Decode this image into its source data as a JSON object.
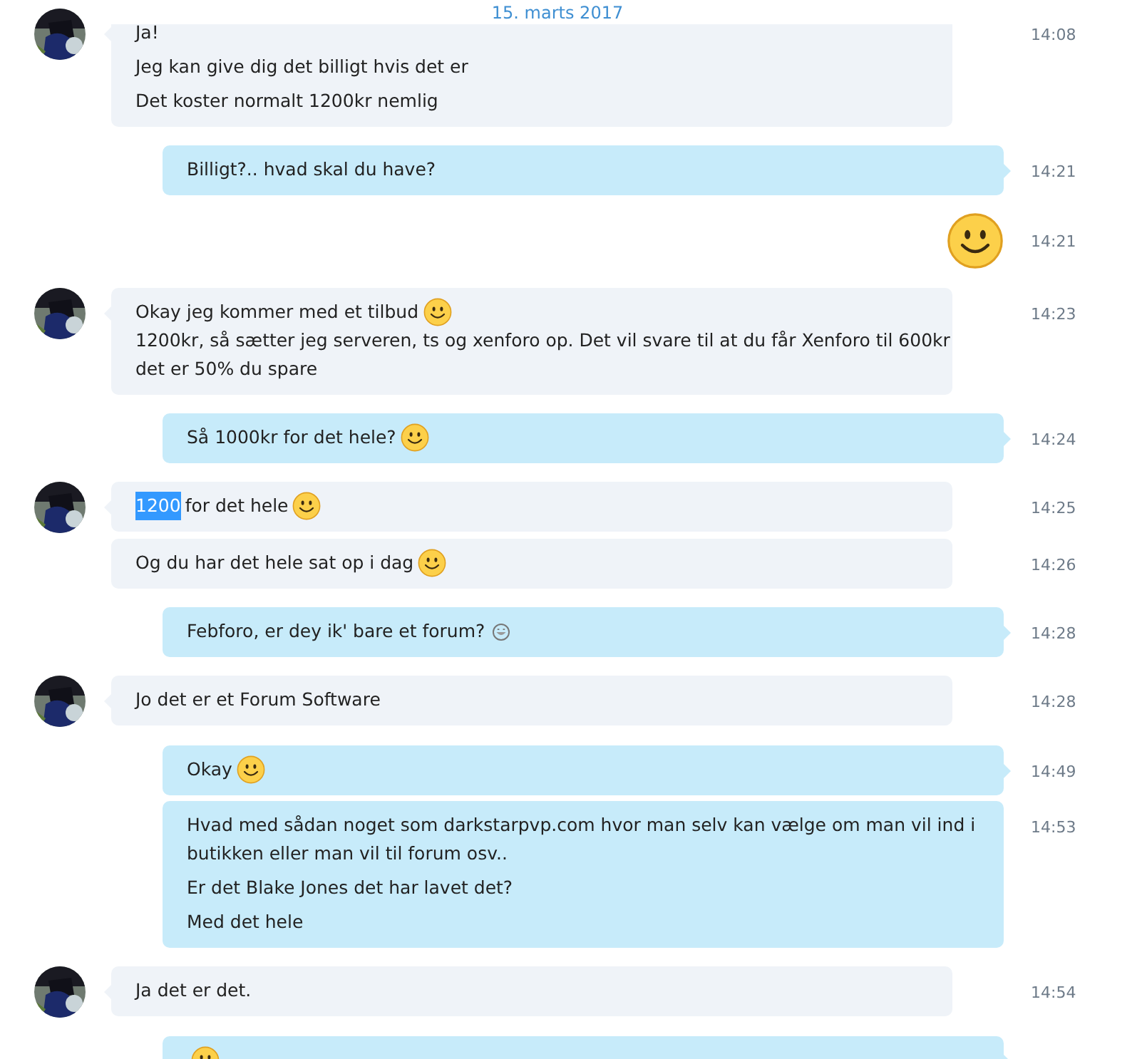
{
  "date_banner": "15. marts 2017",
  "messages": [
    {
      "kind": "received",
      "avatar": true,
      "time": "14:08",
      "paragraphs": [
        {
          "lines": [
            {
              "text": "Ja!"
            }
          ]
        },
        {
          "lines": [
            {
              "text": "Jeg kan give dig det billigt hvis det er"
            }
          ]
        },
        {
          "lines": [
            {
              "text": "Det koster normalt 1200kr nemlig"
            }
          ]
        }
      ]
    },
    {
      "kind": "sent",
      "time": "14:21",
      "paragraphs": [
        {
          "lines": [
            {
              "text": "Billigt?.. hvad skal du have?"
            }
          ]
        }
      ]
    },
    {
      "kind": "big_emoji",
      "time": "14:21",
      "emoji": {
        "kind": "smile"
      }
    },
    {
      "kind": "received",
      "avatar": true,
      "time": "14:23",
      "paragraphs": [
        {
          "lines": [
            {
              "text": "Okay jeg kommer med et tilbud",
              "emoji": {
                "kind": "smile"
              }
            },
            {
              "text": "1200kr, så sætter jeg serveren, ts og xenforo op. Det vil svare til at du får Xenforo til 600kr"
            },
            {
              "text": "det er 50% du spare"
            }
          ]
        }
      ]
    },
    {
      "kind": "sent",
      "time": "14:24",
      "paragraphs": [
        {
          "lines": [
            {
              "text": "Så 1000kr for det hele?",
              "emoji": {
                "kind": "smile"
              }
            }
          ]
        }
      ]
    },
    {
      "kind": "received",
      "avatar": true,
      "time": "14:25",
      "paragraphs": [
        {
          "lines": [
            {
              "selection": "1200",
              "text": "for det hele",
              "emoji": {
                "kind": "smile"
              }
            }
          ]
        }
      ]
    },
    {
      "kind": "received",
      "avatar": false,
      "time": "14:26",
      "paragraphs": [
        {
          "lines": [
            {
              "text": "Og du har det hele sat op i dag",
              "emoji": {
                "kind": "smile"
              }
            }
          ]
        }
      ]
    },
    {
      "kind": "sent",
      "time": "14:28",
      "paragraphs": [
        {
          "lines": [
            {
              "text": "Febforo, er dey ik' bare et forum?",
              "emoji": {
                "kind": "grin"
              }
            }
          ]
        }
      ]
    },
    {
      "kind": "received",
      "avatar": true,
      "time": "14:28",
      "paragraphs": [
        {
          "lines": [
            {
              "text": "Jo det er et Forum Software"
            }
          ]
        }
      ]
    },
    {
      "kind": "sent",
      "time": "14:49",
      "paragraphs": [
        {
          "lines": [
            {
              "text": "Okay",
              "emoji": {
                "kind": "smile"
              }
            }
          ]
        }
      ]
    },
    {
      "kind": "sent",
      "time": "14:53",
      "paragraphs": [
        {
          "lines": [
            {
              "text": "Hvad med sådan noget som darkstarpvp.com hvor man selv kan vælge om man vil ind i"
            },
            {
              "text": "butikken eller man vil til forum osv.."
            }
          ]
        },
        {
          "lines": [
            {
              "text": "Er det Blake Jones det har lavet det?"
            }
          ]
        },
        {
          "lines": [
            {
              "text": "Med det hele"
            }
          ]
        }
      ]
    },
    {
      "kind": "received",
      "avatar": true,
      "time": "14:54",
      "paragraphs": [
        {
          "lines": [
            {
              "text": "Ja det er det."
            }
          ]
        }
      ]
    },
    {
      "kind": "sent",
      "paragraphs": [
        {
          "lines": [
            {
              "emoji": {
                "kind": "smile"
              }
            }
          ]
        }
      ]
    }
  ]
}
